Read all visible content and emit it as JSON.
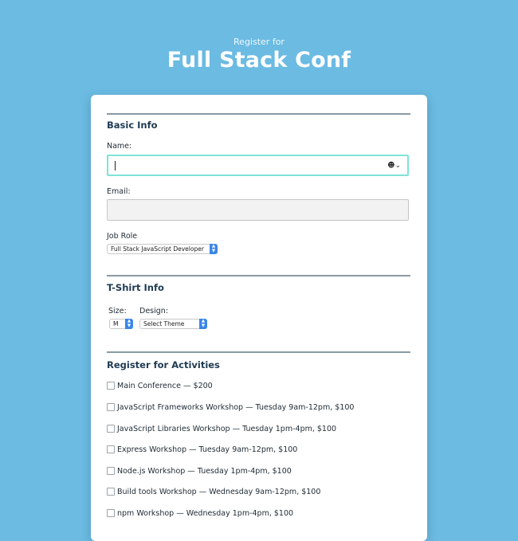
{
  "header": {
    "subtitle": "Register for",
    "title": "Full Stack Conf"
  },
  "basic_info": {
    "title": "Basic Info",
    "name_label": "Name:",
    "name_value": "",
    "email_label": "Email:",
    "email_value": "",
    "job_role_label": "Job Role",
    "job_role_selected": "Full Stack JavaScript Developer"
  },
  "tshirt": {
    "title": "T-Shirt Info",
    "size_label": "Size:",
    "size_selected": "M",
    "design_label": "Design:",
    "design_selected": "Select Theme"
  },
  "activities": {
    "title": "Register for Activities",
    "items": [
      {
        "label": "Main Conference — $200",
        "checked": false
      },
      {
        "label": "JavaScript Frameworks Workshop — Tuesday 9am-12pm, $100",
        "checked": false
      },
      {
        "label": "JavaScript Libraries Workshop — Tuesday 1pm-4pm, $100",
        "checked": false
      },
      {
        "label": "Express Workshop — Tuesday 9am-12pm, $100",
        "checked": false
      },
      {
        "label": "Node.js Workshop — Tuesday 1pm-4pm, $100",
        "checked": false
      },
      {
        "label": "Build tools Workshop — Wednesday 9am-12pm, $100",
        "checked": false
      },
      {
        "label": "npm Workshop — Wednesday 1pm-4pm, $100",
        "checked": false
      }
    ]
  },
  "icons": {
    "autofill": "contact-autofill-icon",
    "select_arrow": "up-down-chevron-icon"
  },
  "colors": {
    "background": "#6bbbe3",
    "card": "#ffffff",
    "section_title": "#1e3a52",
    "focus_border": "#7fe3d8",
    "select_accent": "#3b86e8"
  }
}
